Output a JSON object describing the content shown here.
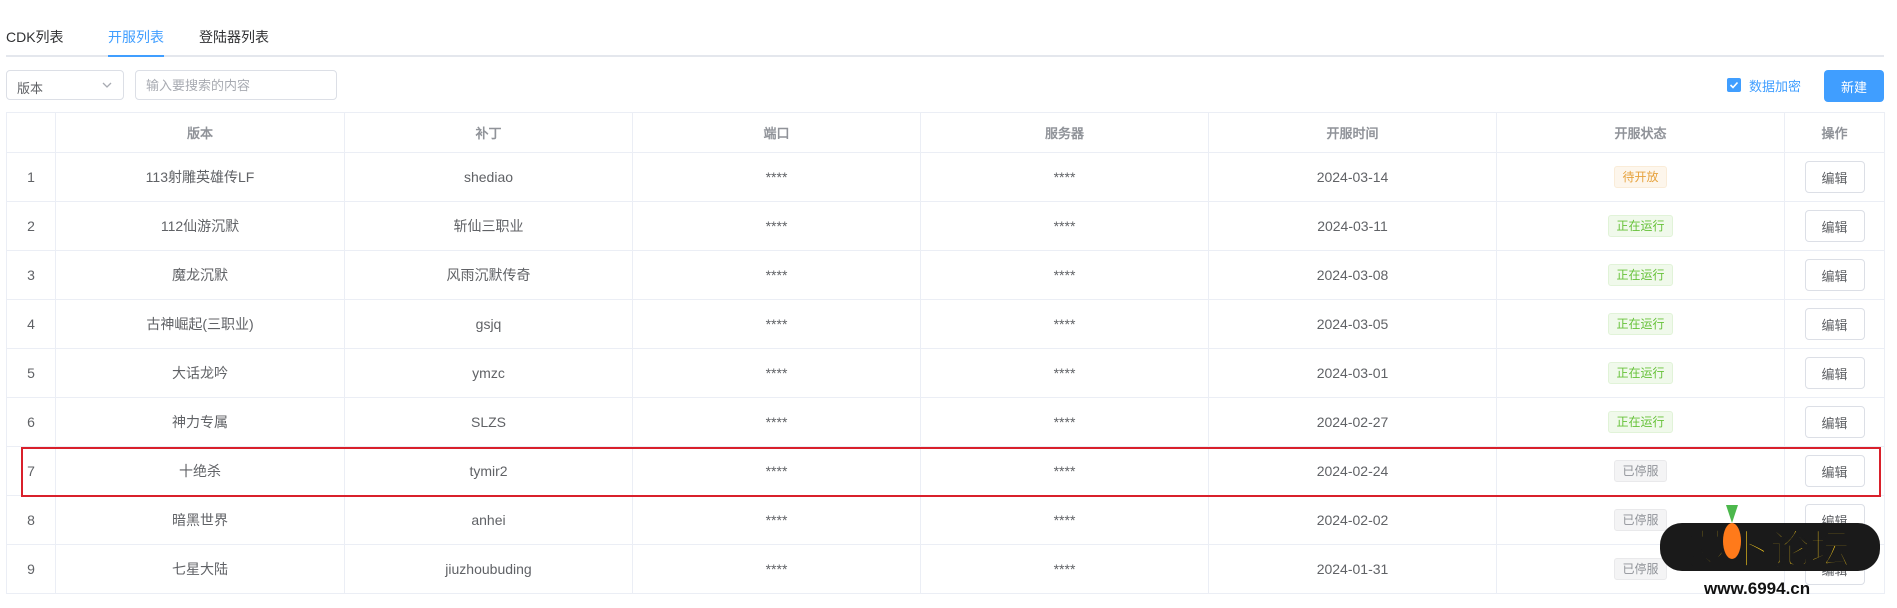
{
  "tabs": [
    {
      "label": "CDK列表",
      "active": false
    },
    {
      "label": "开服列表",
      "active": true
    },
    {
      "label": "登陆器列表",
      "active": false
    }
  ],
  "toolbar": {
    "filter_select_value": "版本",
    "search_placeholder": "输入要搜索的内容",
    "encrypt_label": "数据加密",
    "encrypt_checked": true,
    "new_button_label": "新建"
  },
  "table": {
    "columns": [
      "",
      "版本",
      "补丁",
      "端口",
      "服务器",
      "开服时间",
      "开服状态",
      "操作"
    ],
    "edit_label": "编辑",
    "rows": [
      {
        "index": "1",
        "version": "113射雕英雄传LF",
        "patch": "shediao",
        "port": "****",
        "server": "****",
        "date": "2024-03-14",
        "status": "待开放",
        "status_type": "pending"
      },
      {
        "index": "2",
        "version": "112仙游沉默",
        "patch": "斩仙三职业",
        "port": "****",
        "server": "****",
        "date": "2024-03-11",
        "status": "正在运行",
        "status_type": "running"
      },
      {
        "index": "3",
        "version": "魔龙沉默",
        "patch": "风雨沉默传奇",
        "port": "****",
        "server": "****",
        "date": "2024-03-08",
        "status": "正在运行",
        "status_type": "running"
      },
      {
        "index": "4",
        "version": "古神崛起(三职业)",
        "patch": "gsjq",
        "port": "****",
        "server": "****",
        "date": "2024-03-05",
        "status": "正在运行",
        "status_type": "running"
      },
      {
        "index": "5",
        "version": "大话龙吟",
        "patch": "ymzc",
        "port": "****",
        "server": "****",
        "date": "2024-03-01",
        "status": "正在运行",
        "status_type": "running"
      },
      {
        "index": "6",
        "version": "神力专属",
        "patch": "SLZS",
        "port": "****",
        "server": "****",
        "date": "2024-02-27",
        "status": "正在运行",
        "status_type": "running"
      },
      {
        "index": "7",
        "version": "十绝杀",
        "patch": "tymir2",
        "port": "****",
        "server": "****",
        "date": "2024-02-24",
        "status": "已停服",
        "status_type": "stopped"
      },
      {
        "index": "8",
        "version": "暗黑世界",
        "patch": "anhei",
        "port": "****",
        "server": "****",
        "date": "2024-02-02",
        "status": "已停服",
        "status_type": "stopped"
      },
      {
        "index": "9",
        "version": "七星大陆",
        "patch": "jiuzhoubuding",
        "port": "****",
        "server": "****",
        "date": "2024-01-31",
        "status": "已停服",
        "status_type": "stopped"
      }
    ]
  },
  "status_colors": {
    "pending": {
      "text": "#e6a23c",
      "bg": "#fdf6ec",
      "border": "#faecd8"
    },
    "running": {
      "text": "#67c23a",
      "bg": "#f0f9eb",
      "border": "#e1f3d8"
    },
    "stopped": {
      "text": "#909399",
      "bg": "#f4f4f5",
      "border": "#e9e9eb"
    }
  },
  "colors": {
    "primary": "#409eff",
    "highlight": "#d9202b"
  },
  "watermark": {
    "brand": "萝卜论坛",
    "domain": "www.6994.cn"
  }
}
